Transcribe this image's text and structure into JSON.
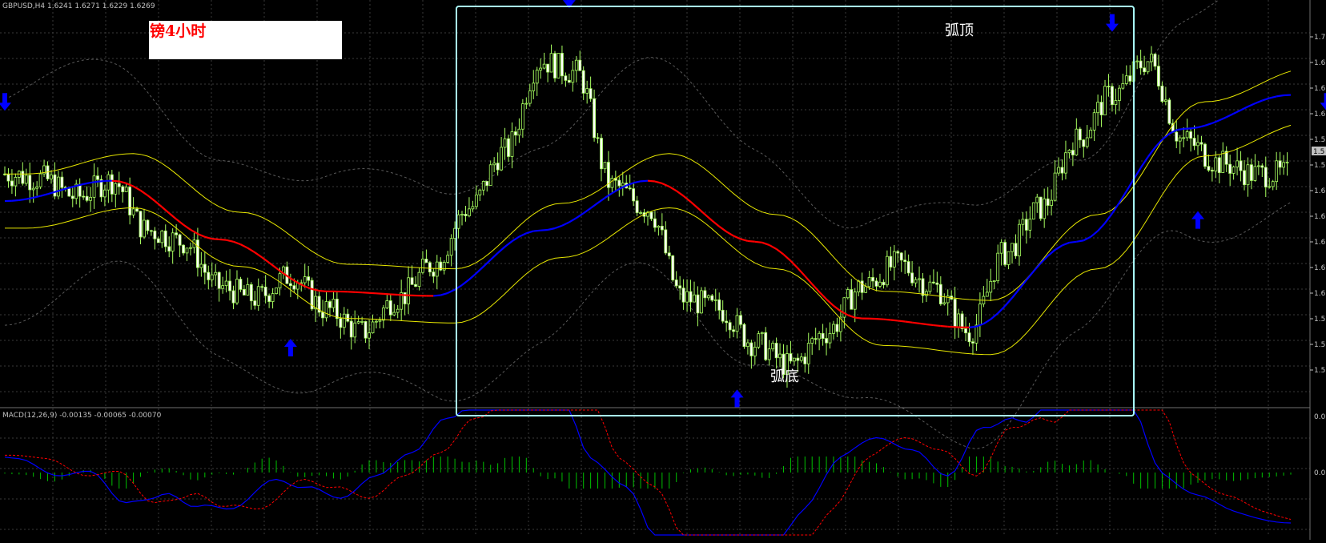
{
  "main_chart": {
    "info_line": "GBPUSD,H4  1.6241  1.6271  1.6229  1.6269",
    "symbol": "GBPUSD",
    "timeframe": "H4",
    "title_box": "镑4小时",
    "annotation_top": "弧顶",
    "annotation_bottom": "弧底",
    "price_ticks": [
      "1.7",
      "1.6",
      "1.6",
      "1.6",
      "1.5",
      "1.5",
      "1.6",
      "1.6",
      "1.6",
      "1.6",
      "1.6",
      "1.5",
      "1.5",
      "1.5"
    ],
    "current_price": "1.5"
  },
  "macd_panel": {
    "info_line": "MACD(12,26,9) -0.00135 -0.00065 -0.00070",
    "ticks": [
      "0.0",
      "0.0"
    ]
  },
  "colors": {
    "background": "#000000",
    "grid": "#3a3a3a",
    "candle": "#a8ff60",
    "ma_up": "#0000ff",
    "ma_down": "#ff0000",
    "yellow_bands": "#e6e600",
    "bollinger": "#5a5a5a",
    "arrows": "#0000ff",
    "highlight_box": "#aaffff",
    "macd_line": "#0000ff",
    "macd_signal": "#ff0000",
    "histogram": "#00c000"
  },
  "chart_data": [
    {
      "type": "candlestick",
      "title": "GBPUSD,H4",
      "ylim": [
        1.52,
        1.68
      ],
      "legend": "none",
      "grid": true,
      "close_series": {
        "x": [
          0,
          10,
          20,
          30,
          40,
          50,
          60,
          70,
          80,
          90,
          100,
          110,
          120,
          130,
          140,
          150,
          160,
          170,
          180,
          190,
          200,
          210,
          220,
          230,
          240,
          250,
          260,
          270,
          280,
          290,
          300,
          310,
          320,
          330,
          340,
          350
        ],
        "values": [
          1.615,
          1.613,
          1.605,
          1.612,
          1.59,
          1.585,
          1.565,
          1.56,
          1.57,
          1.555,
          1.545,
          1.56,
          1.575,
          1.6,
          1.625,
          1.665,
          1.66,
          1.61,
          1.6,
          1.56,
          1.555,
          1.54,
          1.53,
          1.545,
          1.565,
          1.575,
          1.565,
          1.545,
          1.58,
          1.6,
          1.63,
          1.65,
          1.665,
          1.63,
          1.62,
          1.615
        ]
      },
      "ma_series": {
        "x": [
          0,
          30,
          60,
          90,
          120,
          150,
          180,
          210,
          240,
          270,
          300,
          330,
          360
        ],
        "values": [
          1.603,
          1.612,
          1.586,
          1.563,
          1.561,
          1.59,
          1.612,
          1.585,
          1.551,
          1.547,
          1.585,
          1.635,
          1.65
        ]
      },
      "signals": [
        {
          "kind": "down",
          "x": 0
        },
        {
          "kind": "up",
          "x": 80
        },
        {
          "kind": "down",
          "x": 158
        },
        {
          "kind": "up",
          "x": 205
        },
        {
          "kind": "down",
          "x": 310
        },
        {
          "kind": "up",
          "x": 334
        },
        {
          "kind": "down",
          "x": 370
        },
        {
          "kind": "up",
          "x": 384
        }
      ]
    },
    {
      "type": "line",
      "title": "MACD(12,26,9)",
      "values_current": [
        -0.00135,
        -0.00065,
        -0.0007
      ]
    }
  ]
}
